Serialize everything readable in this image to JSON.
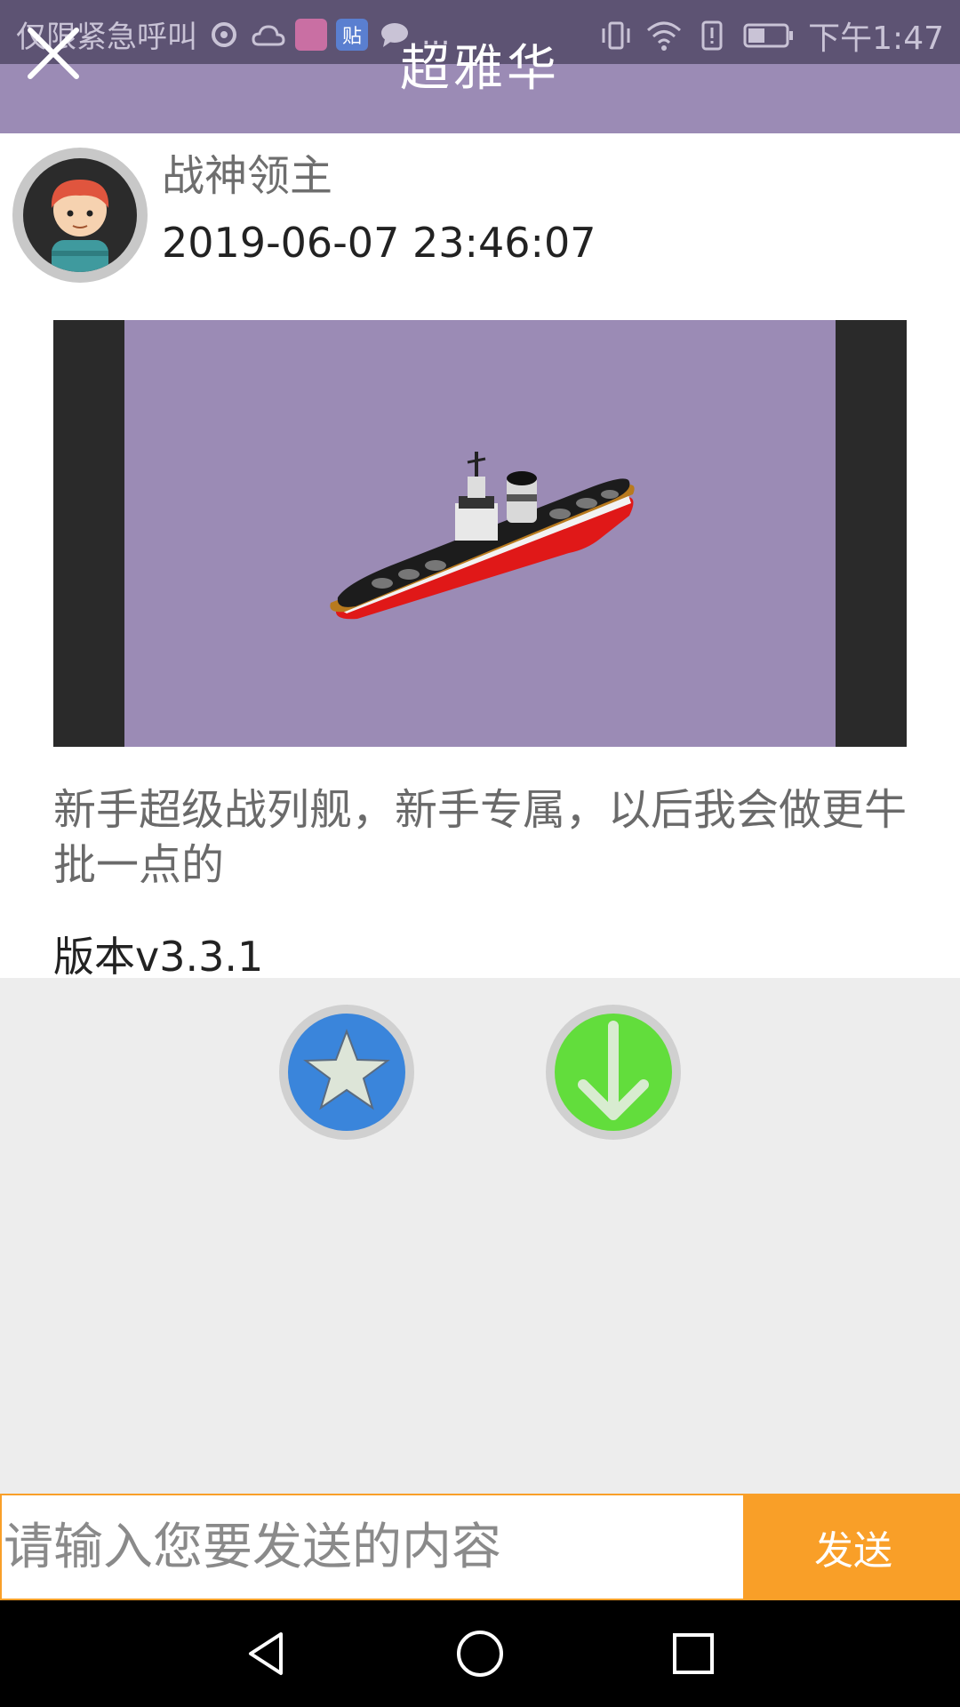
{
  "status_bar": {
    "carrier_text": "仅限紧急呼叫",
    "more_dots": "...",
    "time": "下午1:47",
    "icons": [
      "weibo-icon",
      "weather-icon",
      "video-app-icon",
      "tieba-icon",
      "chat-icon",
      "vibrate-icon",
      "wifi-icon",
      "alert-icon",
      "battery-icon"
    ]
  },
  "header": {
    "title": "超雅华",
    "close_icon": "close-icon",
    "background_color": "#9b8bb5"
  },
  "post": {
    "author": "战神领主",
    "timestamp": "2019-06-07 23:46:07",
    "description": "新手超级战列舰，新手专属，以后我会做更牛批一点的",
    "version": "版本v3.3.1"
  },
  "actions": {
    "favorite_icon": "star-icon",
    "download_icon": "arrow-down-icon",
    "favorite_color": "#3a85db",
    "download_color": "#62dd3c"
  },
  "comment": {
    "placeholder": "请输入您要发送的内容",
    "value": "",
    "send_label": "发送",
    "accent_color": "#f99f28"
  },
  "nav": {
    "back_icon": "back-triangle-icon",
    "home_icon": "home-circle-icon",
    "recent_icon": "recent-square-icon"
  }
}
